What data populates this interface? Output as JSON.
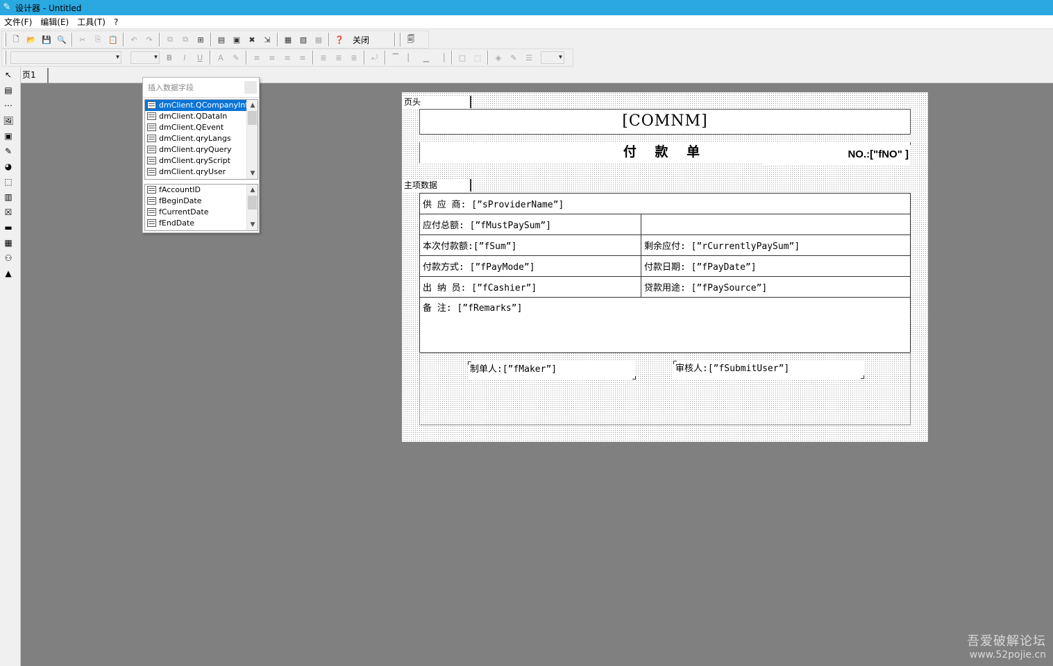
{
  "window": {
    "title": "设计器 - Untitled",
    "app_icon": "pen-logo-icon"
  },
  "menu": [
    "文件(F)",
    "编辑(E)",
    "工具(T)",
    "?"
  ],
  "toolbar": {
    "close_label": "关闭"
  },
  "page_tab": "页1",
  "popup": {
    "title": "插入数据字段",
    "datasets": [
      "dmClient.QCompanyInfo",
      "dmClient.QDataIn",
      "dmClient.QEvent",
      "dmClient.qryLangs",
      "dmClient.qryQuery",
      "dmClient.qryScript",
      "dmClient.qryUser"
    ],
    "selected_dataset": "dmClient.QCompanyInfo",
    "fields": [
      "fAccountID",
      "fBeginDate",
      "fCurrentDate",
      "fEndDate"
    ]
  },
  "report": {
    "band_header": "页头",
    "band_master": "主项数据",
    "company": "[COMNM]",
    "doc_title": "付 款 单",
    "doc_no": "NO.:[\"fNO\" ]",
    "rows": {
      "supplier": "供 应 商: [”sProviderName”]",
      "must_pay": "应付总额: [”fMustPaySum”]",
      "this_pay": "本次付款额:[”fSum”]",
      "remaining": "剩余应付: [”rCurrentlyPaySum”]",
      "pay_mode": "付款方式: [”fPayMode”]",
      "pay_date": "付款日期: [”fPayDate”]",
      "cashier": "出 纳 员: [”fCashier”]",
      "pay_source": "贷款用途: [”fPaySource”]",
      "remarks": "备    注: [”fRemarks”]"
    },
    "maker": "制单人:[”fMaker”]",
    "auditor": "审核人:[”fSubmitUser”]"
  },
  "watermark": {
    "line1": "吾爱破解论坛",
    "line2": "www.52pojie.cn"
  }
}
